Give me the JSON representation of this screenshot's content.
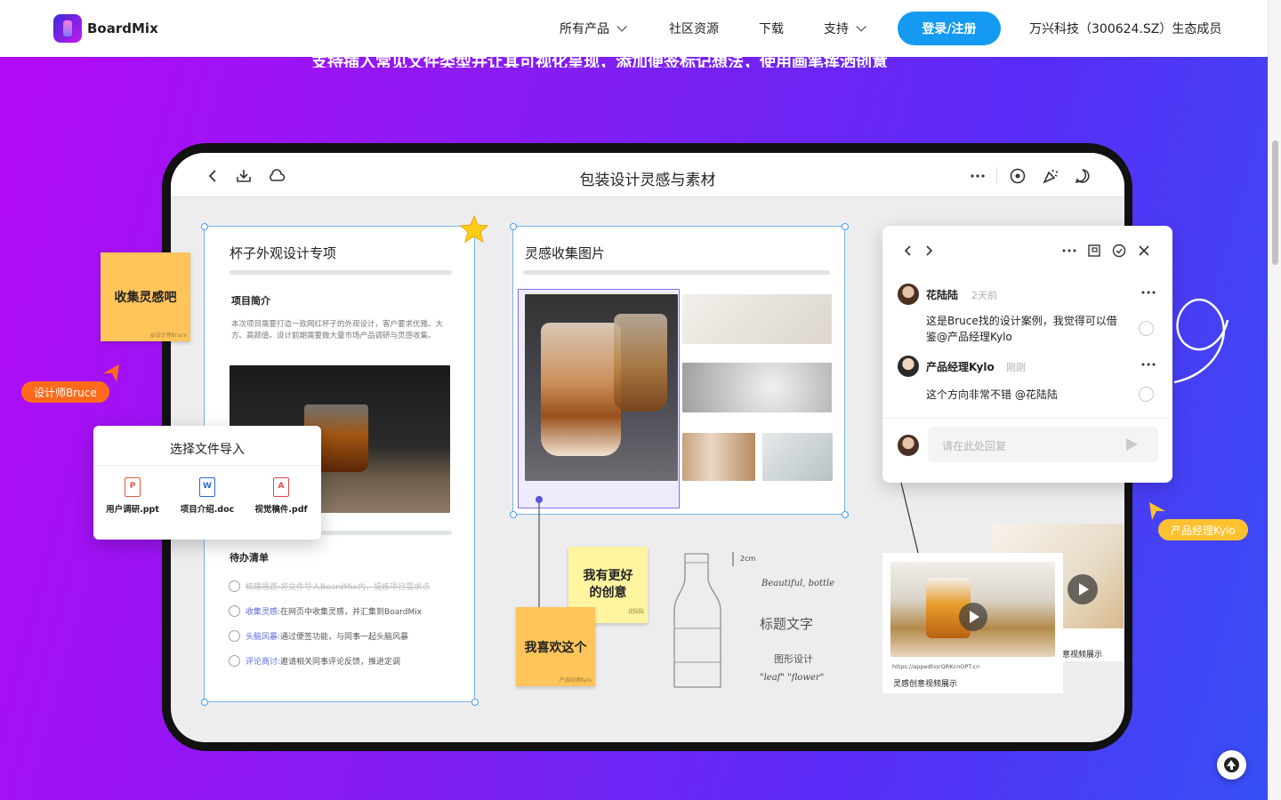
{
  "nav": {
    "logo_text": "BoardMix",
    "products": "所有产品",
    "community": "社区资源",
    "download": "下载",
    "support": "支持",
    "login": "登录/注册",
    "ecosystem": "万兴科技（300624.SZ）生态成员"
  },
  "hero": {
    "subtitle": "支持插入常见文件类型并让其可视化呈现，添加便签标记想法，使用画笔挥洒创意"
  },
  "board": {
    "title": "包装设计灵感与素材",
    "project_frame": {
      "title": "杯子外观设计专项",
      "intro_heading": "项目简介",
      "intro_text": "本次项目需要打造一款网红杯子的外观设计，客户要求优雅、大方、高颜值。设计前期需要做大量市场产品调研与灵感收集。",
      "todo_heading": "待办清单",
      "todos": [
        {
          "tag": "梳理思路:",
          "text": "将文件导入BoardMix内，提炼项目需求点",
          "done": true
        },
        {
          "tag": "收集灵感:",
          "text": "在网页中收集灵感，并汇集到BoardMix",
          "done": false
        },
        {
          "tag": "头脑风暴:",
          "text": "通过便签功能，与同事一起头脑风暴",
          "done": false
        },
        {
          "tag": "评论商讨:",
          "text": "邀请相关同事评论反馈，推进定调",
          "done": false
        }
      ]
    },
    "inspiration_frame": {
      "title": "灵感收集图片"
    },
    "import_modal": {
      "title": "选择文件导入",
      "files": [
        "用户调研.ppt",
        "项目介绍.doc",
        "视觉稿件.pdf"
      ],
      "file_types": [
        "P",
        "W",
        "A"
      ]
    },
    "stickies": {
      "collect": "收集灵感吧",
      "collect_sig": "@设计师Bruce",
      "better_idea": "我有更好的创意",
      "better_sig": "花陆陆",
      "like": "我喜欢这个",
      "like_sig": "产品经理Kylo"
    },
    "cursors": {
      "designer": "设计师Bruce",
      "pm": "产品经理Kylo"
    },
    "sketch": {
      "dimension": "2cm",
      "note1": "Beautiful, bottle",
      "note2": "标题文字",
      "note3": "图形设计",
      "note4": "\"leaf\" \"flower\""
    },
    "comments": {
      "items": [
        {
          "name": "花陆陆",
          "time": "2天前",
          "text": "这是Bruce找的设计案例，我觉得可以借鉴@产品经理Kylo"
        },
        {
          "name": "产品经理Kylo",
          "time": "刚刚",
          "text": "这个方向非常不错 @花陆陆"
        }
      ],
      "reply_placeholder": "请在此处回复"
    },
    "video_card": {
      "url": "https://appedtiorQRKcnOPT.cn",
      "caption": "灵感创意视频展示",
      "caption_back": "意视频展示"
    }
  },
  "colors": {
    "accent": "#149af0",
    "sticky_orange": "#ffc45a",
    "sticky_yellow": "#fff5a0",
    "pill_orange": "#ff6a1a",
    "pill_yellow": "#ffc12e"
  }
}
